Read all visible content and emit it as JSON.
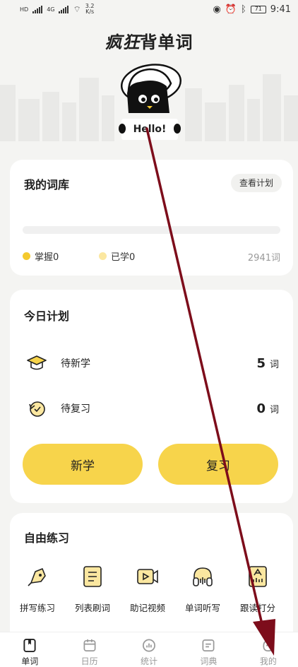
{
  "status_bar": {
    "left_labels": [
      "HD",
      "4G",
      "4G"
    ],
    "speed_value": "3.2",
    "speed_unit": "K/s",
    "battery": "71",
    "time": "9:41"
  },
  "app": {
    "title_fancy": "疯狂",
    "title_rest": "背单词"
  },
  "mascot": {
    "greeting": "Hello!"
  },
  "library": {
    "title": "我的词库",
    "view_plan_label": "查看计划",
    "progress": 0,
    "legend": [
      {
        "label": "掌握0",
        "color": "#f4c92e"
      },
      {
        "label": "已学0",
        "color": "#fbe7a0"
      }
    ],
    "total": "2941词"
  },
  "plan": {
    "title": "今日计划",
    "rows": [
      {
        "label": "待新学",
        "count": "5",
        "unit": "词",
        "icon": "graduation-cap-icon"
      },
      {
        "label": "待复习",
        "count": "0",
        "unit": "词",
        "icon": "review-clock-icon"
      }
    ],
    "new_button": "新学",
    "review_button": "复习"
  },
  "practice": {
    "title": "自由练习",
    "tools": [
      {
        "label": "拼写练习",
        "icon": "pen-icon"
      },
      {
        "label": "列表刷词",
        "icon": "list-icon"
      },
      {
        "label": "助记视频",
        "icon": "video-icon"
      },
      {
        "label": "单词听写",
        "icon": "headphones-icon"
      },
      {
        "label": "跟读打分",
        "icon": "score-icon"
      }
    ]
  },
  "tabs": [
    {
      "label": "单词",
      "icon": "book-icon",
      "active": true
    },
    {
      "label": "日历",
      "icon": "calendar-icon",
      "active": false
    },
    {
      "label": "统计",
      "icon": "stats-icon",
      "active": false
    },
    {
      "label": "词典",
      "icon": "dictionary-icon",
      "active": false
    },
    {
      "label": "我的",
      "icon": "profile-icon",
      "active": false
    }
  ],
  "colors": {
    "accent": "#f7d44b",
    "annotation_arrow": "#7d0d1b"
  }
}
